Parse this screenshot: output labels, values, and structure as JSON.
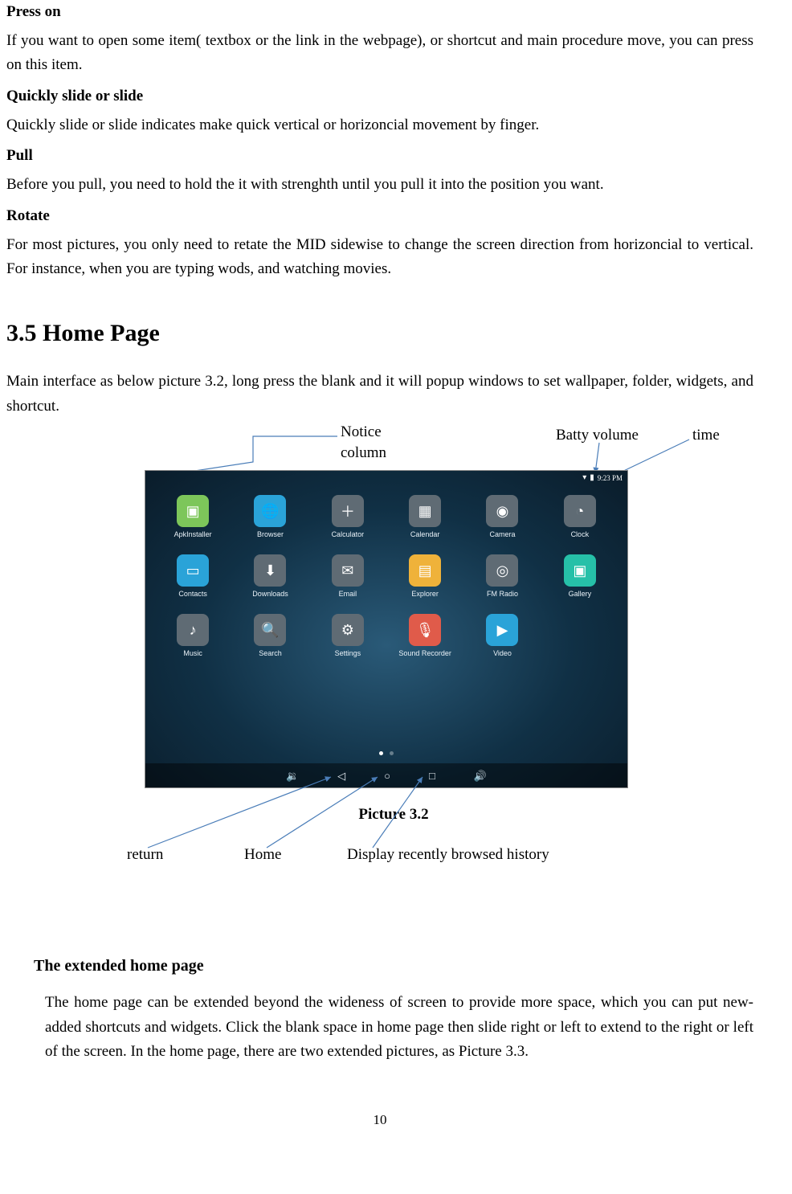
{
  "section1": {
    "h_press": "Press on",
    "p_press": "If you want to open some item( textbox or the link in the webpage), or shortcut and main procedure move, you can press on this item.",
    "h_slide": "Quickly slide or slide",
    "p_slide": "Quickly slide or slide indicates make quick vertical or horizoncial movement by finger.",
    "h_pull": "Pull",
    "p_pull": "Before you pull, you need to hold the it with strenghth until you pull it into the position you want.",
    "h_rotate": "Rotate",
    "p_rotate": "For most pictures, you only need to retate the MID sidewise to change the screen direction from horizoncial to vertical. For instance, when you are typing wods, and watching movies."
  },
  "section2": {
    "title": "3.5 Home Page",
    "intro": "Main interface as below picture 3.2, long press the blank and it will popup windows to set wallpaper, folder, widgets, and shortcut.",
    "ann_notice_l1": "Notice",
    "ann_notice_l2": "column",
    "ann_batty": "Batty volume",
    "ann_time": "time",
    "ann_return": "return",
    "ann_home": "Home",
    "ann_recent": "Display recently browsed history",
    "caption": "Picture 3.2",
    "sub_title": "The extended home page",
    "sub_body": "The home page can be extended beyond the wideness of screen to provide more space, which you can put new-added shortcuts and widgets. Click the blank space in home page then slide right or left to extend to the right or left of the screen. In the home page, there are two extended pictures, as Picture 3.3."
  },
  "screenshot": {
    "time": "9:23 PM",
    "apps_row1": [
      {
        "label": "ApkInstaller",
        "glyph": "▣",
        "bg": "#7dc65a"
      },
      {
        "label": "Browser",
        "glyph": "🌐",
        "bg": "#2aa3d8"
      },
      {
        "label": "Calculator",
        "glyph": "＋",
        "bg": "#5f6b74"
      },
      {
        "label": "Calendar",
        "glyph": "▦",
        "bg": "#5f6b74"
      },
      {
        "label": "Camera",
        "glyph": "◉",
        "bg": "#5f6b74"
      },
      {
        "label": "Clock",
        "glyph": "◔",
        "bg": "#5f6b74"
      }
    ],
    "apps_row2": [
      {
        "label": "Contacts",
        "glyph": "▭",
        "bg": "#2aa3d8"
      },
      {
        "label": "Downloads",
        "glyph": "⬇",
        "bg": "#5f6b74"
      },
      {
        "label": "Email",
        "glyph": "✉",
        "bg": "#5f6b74"
      },
      {
        "label": "Explorer",
        "glyph": "▤",
        "bg": "#efb23a"
      },
      {
        "label": "FM Radio",
        "glyph": "◎",
        "bg": "#5f6b74"
      },
      {
        "label": "Gallery",
        "glyph": "▣",
        "bg": "#26c0a8"
      }
    ],
    "apps_row3": [
      {
        "label": "Music",
        "glyph": "♪",
        "bg": "#5f6b74"
      },
      {
        "label": "Search",
        "glyph": "🔍",
        "bg": "#5f6b74"
      },
      {
        "label": "Settings",
        "glyph": "⚙",
        "bg": "#5f6b74"
      },
      {
        "label": "Sound Recorder",
        "glyph": "🎙",
        "bg": "#e05b4a"
      },
      {
        "label": "Video",
        "glyph": "▶",
        "bg": "#2aa3d8"
      }
    ]
  },
  "page_number": "10"
}
